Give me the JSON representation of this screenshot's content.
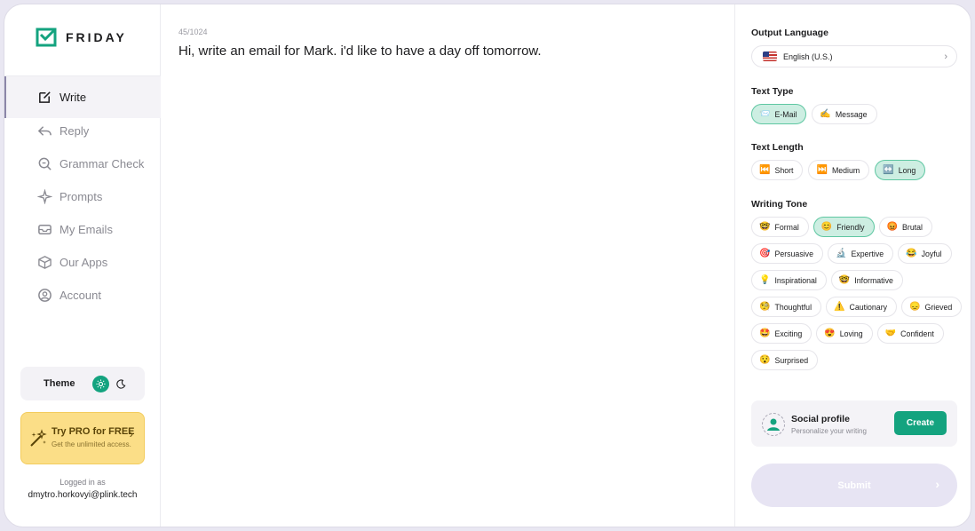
{
  "app": {
    "logo_text": "FRIDAY",
    "accent": "#14a37f",
    "pro_bg": "#fbde87"
  },
  "sidebar": {
    "items": [
      {
        "label": "Write",
        "icon": "edit-icon",
        "active": true
      },
      {
        "label": "Reply",
        "icon": "reply-icon"
      },
      {
        "label": "Grammar Check",
        "icon": "grammar-search-icon"
      },
      {
        "label": "Prompts",
        "icon": "sparkle-icon"
      },
      {
        "label": "My Emails",
        "icon": "inbox-icon"
      },
      {
        "label": "Our Apps",
        "icon": "cube-icon"
      },
      {
        "label": "Account",
        "icon": "user-circle-icon"
      }
    ],
    "theme_label": "Theme",
    "pro_title": "Try PRO for FREE",
    "pro_subtitle": "Get the unlimited access.",
    "logged_in_label": "Logged in as",
    "user_email": "dmytro.horkovyi@plink.tech"
  },
  "editor": {
    "counter": "45/1024",
    "text": "Hi, write an email for Mark. i'd like to have a day off tomorrow."
  },
  "settings": {
    "output_language_title": "Output Language",
    "output_language_value": "English (U.S.)",
    "text_type_title": "Text Type",
    "text_types": [
      {
        "emoji": "📨",
        "label": "E-Mail",
        "selected": true
      },
      {
        "emoji": "✍️",
        "label": "Message"
      }
    ],
    "text_length_title": "Text Length",
    "text_lengths": [
      {
        "emoji": "⏮️",
        "label": "Short"
      },
      {
        "emoji": "⏭️",
        "label": "Medium"
      },
      {
        "emoji": "↔️",
        "label": "Long",
        "selected": true
      }
    ],
    "writing_tone_title": "Writing Tone",
    "tones": [
      {
        "emoji": "🤓",
        "label": "Formal"
      },
      {
        "emoji": "😊",
        "label": "Friendly",
        "selected": true
      },
      {
        "emoji": "😡",
        "label": "Brutal"
      },
      {
        "emoji": "🎯",
        "label": "Persuasive"
      },
      {
        "emoji": "🔬",
        "label": "Expertive"
      },
      {
        "emoji": "😂",
        "label": "Joyful"
      },
      {
        "emoji": "💡",
        "label": "Inspirational"
      },
      {
        "emoji": "🤓",
        "label": "Informative"
      },
      {
        "emoji": "🧐",
        "label": "Thoughtful"
      },
      {
        "emoji": "⚠️",
        "label": "Cautionary"
      },
      {
        "emoji": "😞",
        "label": "Grieved"
      },
      {
        "emoji": "🤩",
        "label": "Exciting"
      },
      {
        "emoji": "😍",
        "label": "Loving"
      },
      {
        "emoji": "🤝",
        "label": "Confident"
      },
      {
        "emoji": "😯",
        "label": "Surprised"
      }
    ],
    "social_title": "Social profile",
    "social_subtitle": "Personalize your writing",
    "create_label": "Create",
    "submit_label": "Submit"
  }
}
